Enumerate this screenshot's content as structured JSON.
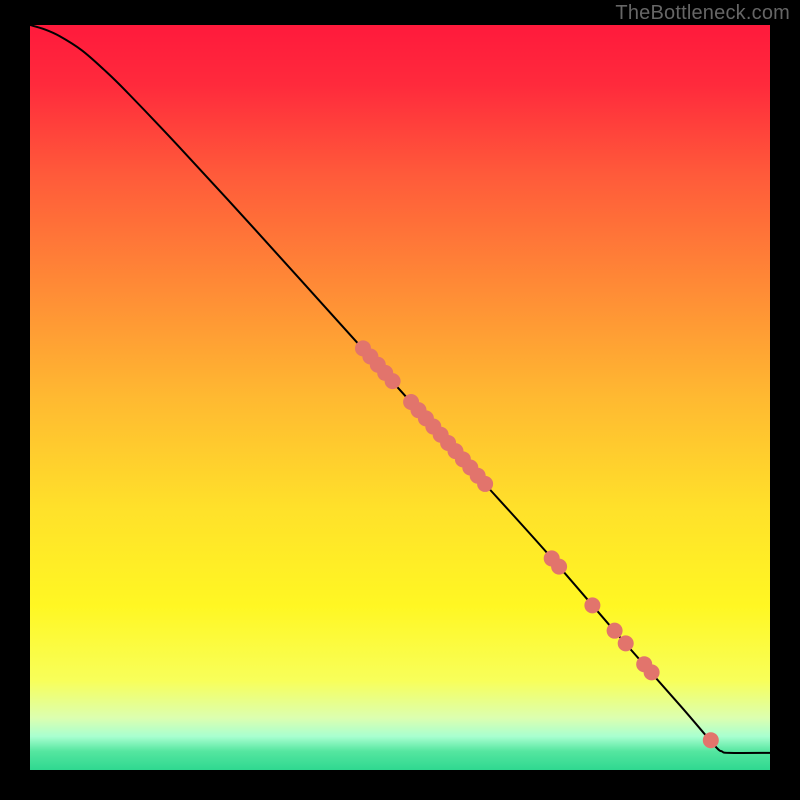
{
  "watermark": "TheBottleneck.com",
  "chart_data": {
    "type": "line",
    "title": "",
    "xlabel": "",
    "ylabel": "",
    "xlim": [
      0,
      100
    ],
    "ylim": [
      0,
      100
    ],
    "grid": false,
    "legend": false,
    "gradient_stops": [
      {
        "offset": 0.0,
        "color": "#ff1a3c"
      },
      {
        "offset": 0.08,
        "color": "#ff2a3c"
      },
      {
        "offset": 0.2,
        "color": "#ff5a3a"
      },
      {
        "offset": 0.35,
        "color": "#ff8a36"
      },
      {
        "offset": 0.5,
        "color": "#ffb931"
      },
      {
        "offset": 0.65,
        "color": "#ffe12a"
      },
      {
        "offset": 0.78,
        "color": "#fff723"
      },
      {
        "offset": 0.88,
        "color": "#f8ff5a"
      },
      {
        "offset": 0.93,
        "color": "#dcffb0"
      },
      {
        "offset": 0.955,
        "color": "#a8ffd0"
      },
      {
        "offset": 0.975,
        "color": "#55e6a0"
      },
      {
        "offset": 1.0,
        "color": "#2fd890"
      }
    ],
    "series": [
      {
        "name": "curve",
        "type": "line",
        "color": "#000000",
        "width": 2,
        "points": [
          {
            "x": 0.0,
            "y": 100.0
          },
          {
            "x": 2.0,
            "y": 99.4
          },
          {
            "x": 4.0,
            "y": 98.5
          },
          {
            "x": 7.0,
            "y": 96.6
          },
          {
            "x": 10.0,
            "y": 94.0
          },
          {
            "x": 13.0,
            "y": 91.1
          },
          {
            "x": 20.0,
            "y": 83.8
          },
          {
            "x": 30.0,
            "y": 73.0
          },
          {
            "x": 40.0,
            "y": 62.0
          },
          {
            "x": 50.0,
            "y": 51.0
          },
          {
            "x": 60.0,
            "y": 40.0
          },
          {
            "x": 70.0,
            "y": 29.0
          },
          {
            "x": 80.0,
            "y": 17.5
          },
          {
            "x": 88.0,
            "y": 8.5
          },
          {
            "x": 92.5,
            "y": 3.3
          },
          {
            "x": 93.5,
            "y": 2.5
          },
          {
            "x": 94.5,
            "y": 2.3
          },
          {
            "x": 100.0,
            "y": 2.3
          }
        ]
      },
      {
        "name": "markers",
        "type": "scatter",
        "color": "#e2746c",
        "radius": 8,
        "points": [
          {
            "x": 45.0,
            "y": 56.6
          },
          {
            "x": 46.0,
            "y": 55.5
          },
          {
            "x": 47.0,
            "y": 54.4
          },
          {
            "x": 48.0,
            "y": 53.3
          },
          {
            "x": 49.0,
            "y": 52.2
          },
          {
            "x": 51.5,
            "y": 49.4
          },
          {
            "x": 52.5,
            "y": 48.3
          },
          {
            "x": 53.5,
            "y": 47.2
          },
          {
            "x": 54.5,
            "y": 46.1
          },
          {
            "x": 55.5,
            "y": 45.0
          },
          {
            "x": 56.5,
            "y": 43.9
          },
          {
            "x": 57.5,
            "y": 42.8
          },
          {
            "x": 58.5,
            "y": 41.7
          },
          {
            "x": 59.5,
            "y": 40.6
          },
          {
            "x": 60.5,
            "y": 39.5
          },
          {
            "x": 61.5,
            "y": 38.4
          },
          {
            "x": 70.5,
            "y": 28.4
          },
          {
            "x": 71.5,
            "y": 27.3
          },
          {
            "x": 76.0,
            "y": 22.1
          },
          {
            "x": 79.0,
            "y": 18.7
          },
          {
            "x": 80.5,
            "y": 17.0
          },
          {
            "x": 83.0,
            "y": 14.2
          },
          {
            "x": 84.0,
            "y": 13.1
          },
          {
            "x": 92.0,
            "y": 4.0
          }
        ]
      }
    ]
  }
}
